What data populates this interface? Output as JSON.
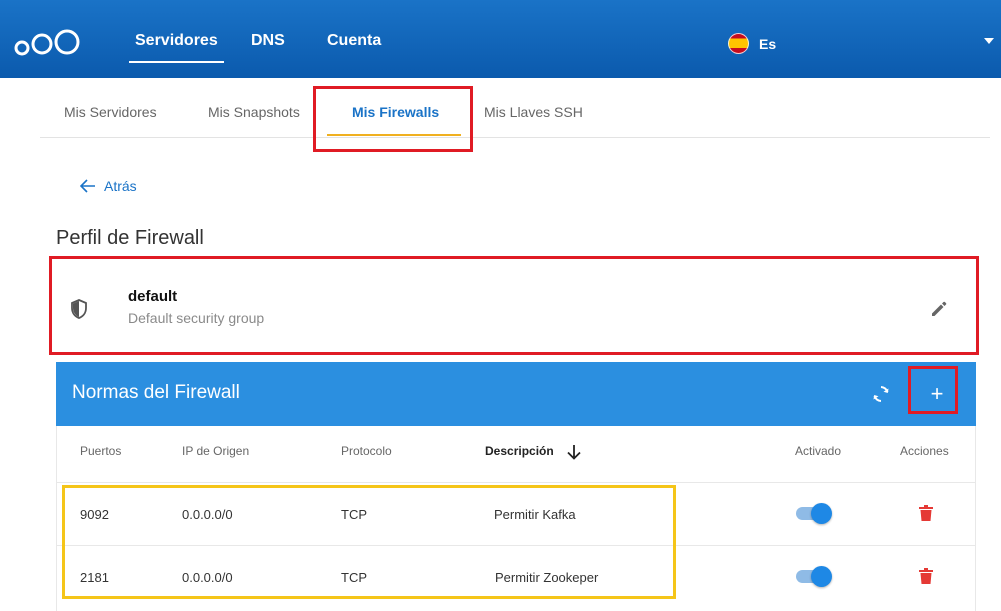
{
  "nav": {
    "items": [
      {
        "label": "Servidores",
        "active": true
      },
      {
        "label": "DNS",
        "active": false
      },
      {
        "label": "Cuenta",
        "active": false
      }
    ],
    "language": {
      "label": "Es",
      "flag": "spain-flag-icon"
    }
  },
  "subtabs": {
    "items": [
      {
        "label": "Mis Servidores",
        "active": false
      },
      {
        "label": "Mis Snapshots",
        "active": false
      },
      {
        "label": "Mis Firewalls",
        "active": true
      },
      {
        "label": "Mis Llaves SSH",
        "active": false
      }
    ]
  },
  "back_label": "Atrás",
  "section_title": "Perfil de Firewall",
  "profile": {
    "name": "default",
    "description": "Default security group"
  },
  "rules": {
    "title": "Normas del Firewall",
    "add_label": "+",
    "columns": {
      "ports": "Puertos",
      "source_ip": "IP de Origen",
      "protocol": "Protocolo",
      "description": "Descripción",
      "enabled": "Activado",
      "actions": "Acciones"
    },
    "rows": [
      {
        "port": "9092",
        "source_ip": "0.0.0.0/0",
        "protocol": "TCP",
        "description": "Permitir Kafka",
        "enabled": true
      },
      {
        "port": "2181",
        "source_ip": "0.0.0.0/0",
        "protocol": "TCP",
        "description": "Permitir Zookeper",
        "enabled": true
      }
    ]
  },
  "colors": {
    "brand_blue": "#1a73c7",
    "header_blue": "#2b8fe0",
    "tab_underline": "#f0b020",
    "highlight_red": "#e01b24",
    "highlight_yellow": "#f5c518",
    "delete_red": "#e53935"
  }
}
